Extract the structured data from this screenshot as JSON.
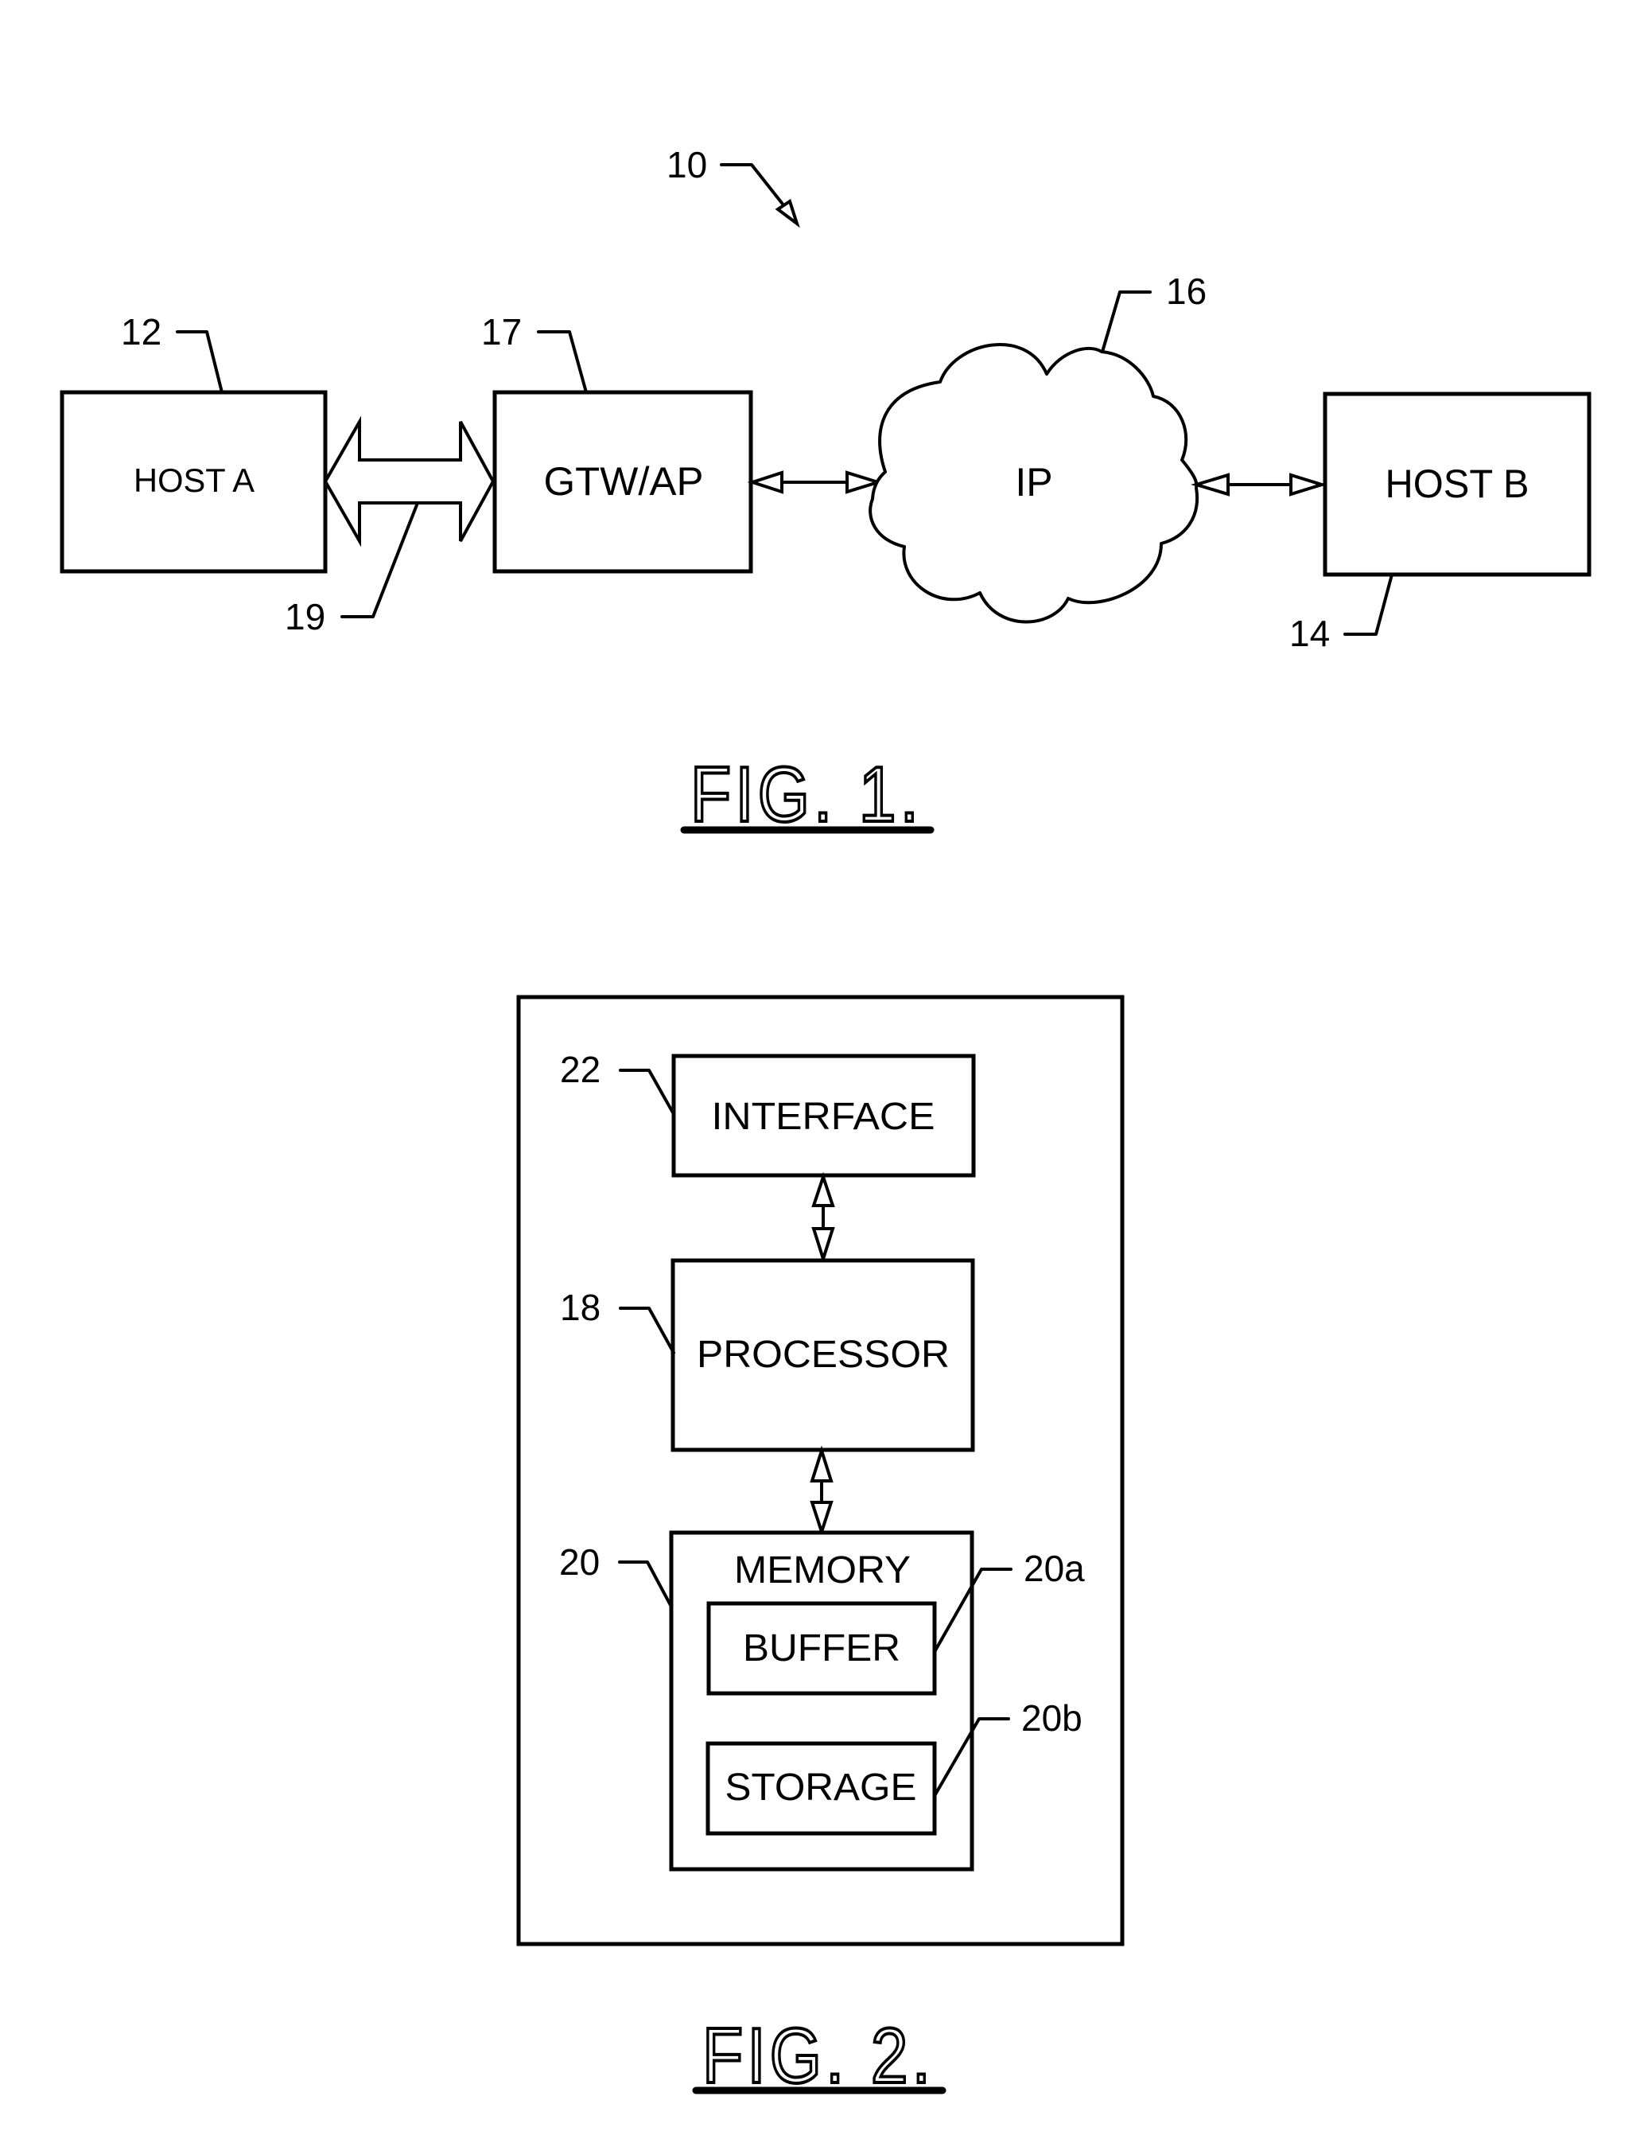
{
  "figure1": {
    "caption": "FIG. 1.",
    "system_ref": "10",
    "nodes": {
      "host_a": {
        "label": "HOST A",
        "ref": "12"
      },
      "gateway": {
        "label": "GTW/AP",
        "ref": "17"
      },
      "network": {
        "label": "IP",
        "ref": "16"
      },
      "host_b": {
        "label": "HOST B",
        "ref": "14"
      }
    },
    "link_host_a_gateway": {
      "ref": "19"
    }
  },
  "figure2": {
    "caption": "FIG. 2.",
    "nodes": {
      "interface": {
        "label": "INTERFACE",
        "ref": "22"
      },
      "processor": {
        "label": "PROCESSOR",
        "ref": "18"
      },
      "memory": {
        "label": "MEMORY",
        "ref": "20"
      },
      "buffer": {
        "label": "BUFFER",
        "ref": "20a"
      },
      "storage": {
        "label": "STORAGE",
        "ref": "20b"
      }
    }
  }
}
